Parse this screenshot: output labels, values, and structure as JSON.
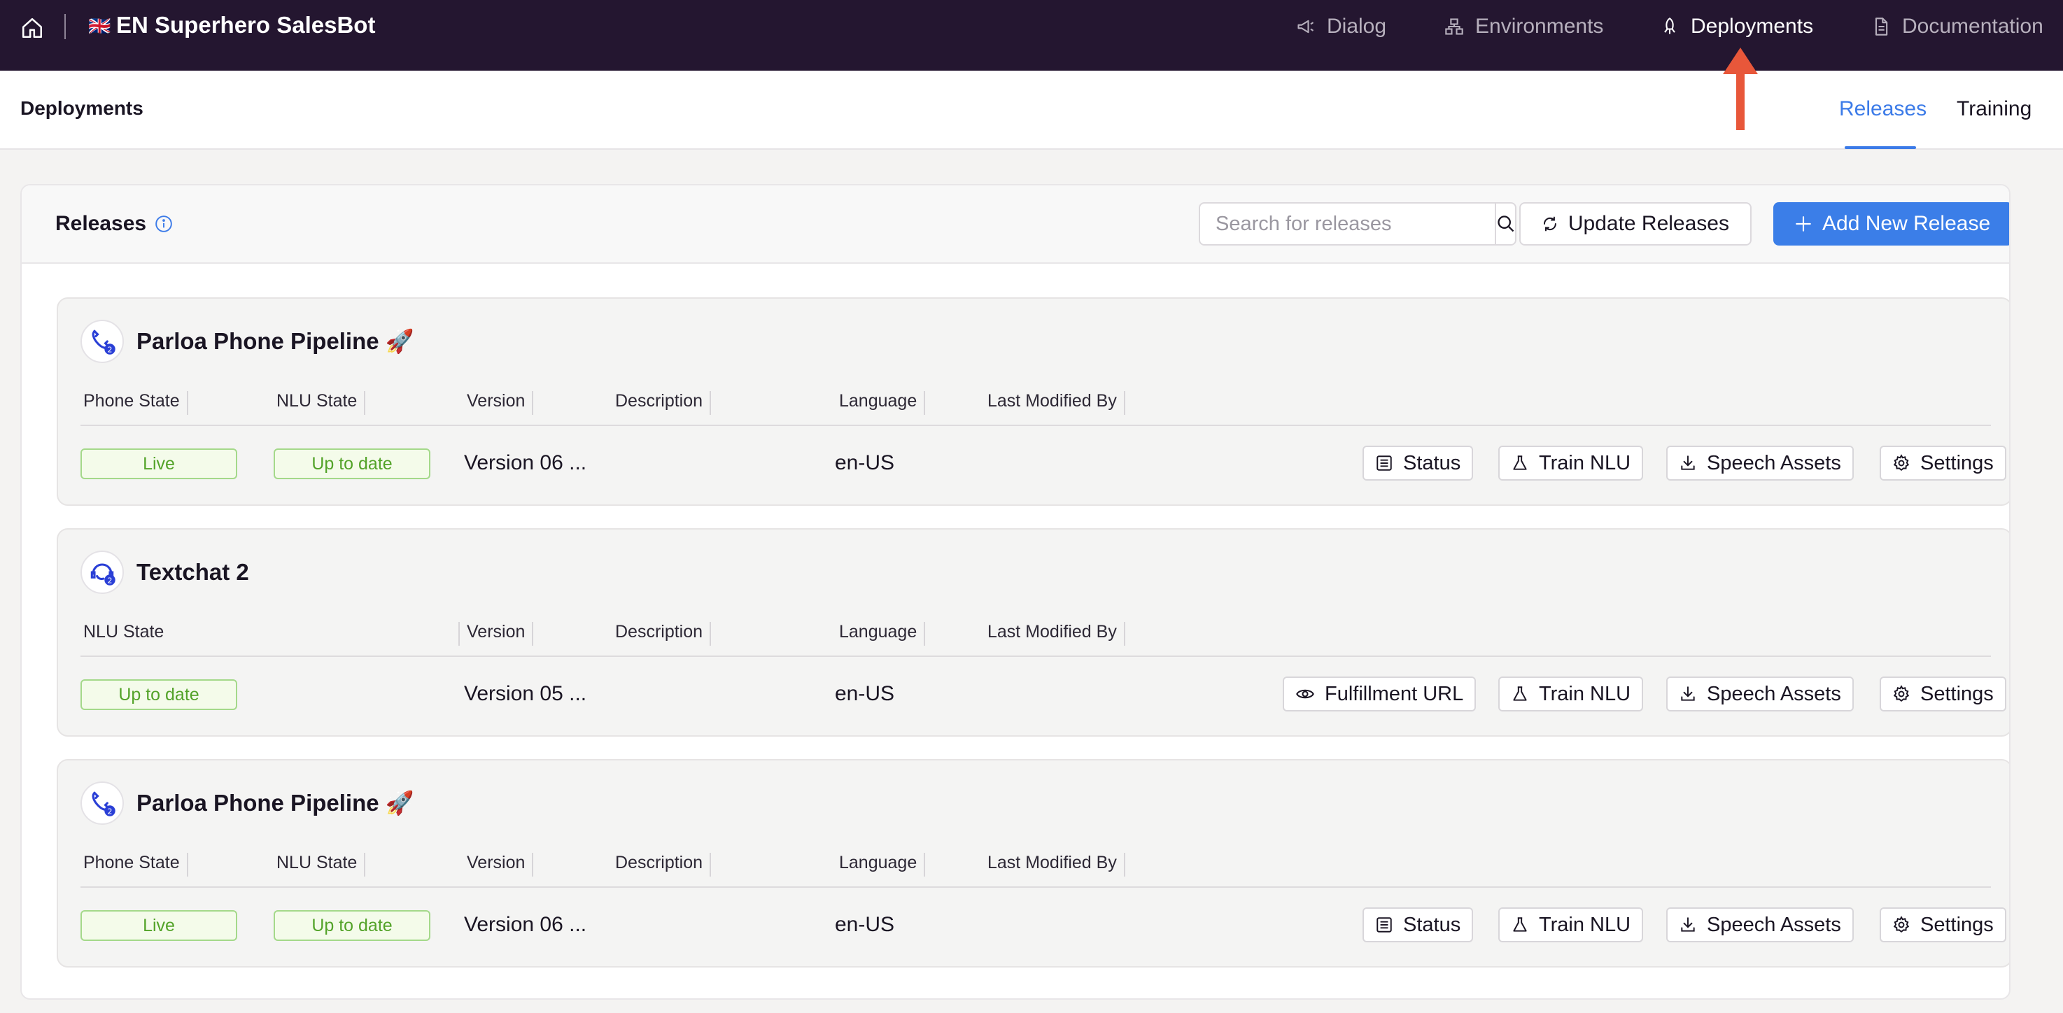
{
  "topbar": {
    "app_flag": "🇬🇧",
    "app_title": "EN Superhero SalesBot",
    "nav": [
      {
        "label": "Dialog",
        "icon": "megaphone-icon"
      },
      {
        "label": "Environments",
        "icon": "network-icon"
      },
      {
        "label": "Deployments",
        "icon": "rocket-icon",
        "active": true
      },
      {
        "label": "Documentation",
        "icon": "document-icon"
      }
    ]
  },
  "subheader": {
    "title": "Deployments",
    "tabs": [
      {
        "label": "Releases",
        "active": true
      },
      {
        "label": "Training"
      }
    ]
  },
  "releases_card": {
    "title": "Releases",
    "search_placeholder": "Search for releases",
    "update_label": "Update Releases",
    "add_label": "Add New Release"
  },
  "columns": {
    "phone_state": "Phone State",
    "nlu_state": "NLU State",
    "version": "Version",
    "description": "Description",
    "language": "Language",
    "last_modified_by": "Last Modified By"
  },
  "releases": [
    {
      "name": "Parloa Phone Pipeline 🚀",
      "phone_state": "Live",
      "nlu_state": "Up to date",
      "version": "Version 06 ...",
      "description": "",
      "language": "en-US",
      "last_modified_by": "",
      "actions": [
        "Status",
        "Train NLU",
        "Speech Assets",
        "Settings"
      ]
    },
    {
      "name": "Textchat 2",
      "nlu_state": "Up to date",
      "version": "Version 05 ...",
      "description": "",
      "language": "en-US",
      "last_modified_by": "",
      "actions": [
        "Fulfillment URL",
        "Train NLU",
        "Speech Assets",
        "Settings"
      ]
    },
    {
      "name": "Parloa Phone Pipeline 🚀",
      "phone_state": "Live",
      "nlu_state": "Up to date",
      "version": "Version 06 ...",
      "description": "",
      "language": "en-US",
      "last_modified_by": "",
      "actions": [
        "Status",
        "Train NLU",
        "Speech Assets",
        "Settings"
      ]
    }
  ],
  "colors": {
    "topbar_bg": "#241630",
    "accent_blue": "#3b7ee8",
    "badge_green": "#53a329",
    "annotation_arrow": "#e8573a"
  }
}
